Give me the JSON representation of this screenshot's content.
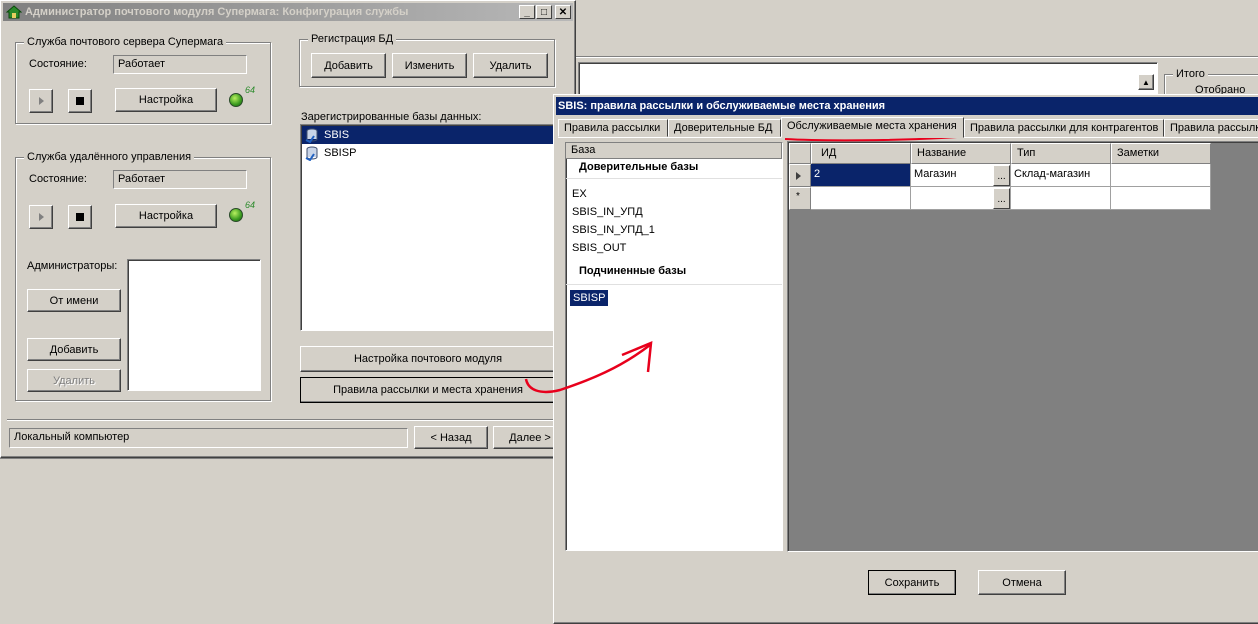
{
  "main_window": {
    "title": "Администратор почтового модуля Супермага: Конфигурация службы",
    "mail_service": {
      "group_title": "Служба почтового сервера Супермага",
      "state_label": "Состояние:",
      "state_value": "Работает",
      "settings_button": "Настройка",
      "led_number": "64"
    },
    "remote_service": {
      "group_title": "Служба удалённого управления",
      "state_label": "Состояние:",
      "state_value": "Работает",
      "settings_button": "Настройка",
      "led_number": "64"
    },
    "admins": {
      "label": "Администраторы:",
      "as_user_button": "От имени",
      "add_button": "Добавить",
      "delete_button": "Удалить"
    },
    "db_registration": {
      "group_title": "Регистрация БД",
      "add_button": "Добавить",
      "edit_button": "Изменить",
      "delete_button": "Удалить"
    },
    "registered_dbs": {
      "label": "Зарегистрированные базы данных:",
      "items": [
        "SBIS",
        "SBISP"
      ],
      "selected": "SBIS"
    },
    "mail_module_settings_button": "Настройка почтового модуля",
    "rules_button": "Правила рассылки и места хранения",
    "status_field": "Локальный компьютер",
    "back_button": "< Назад",
    "next_button": "Далее >"
  },
  "background_panel": {
    "total_label": "Итого",
    "shown_label": "Отобрано"
  },
  "dialog": {
    "title": "SBIS: правила рассылки и обслуживаемые места хранения",
    "tabs": [
      "Правила рассылки",
      "Доверительные БД",
      "Обслуживаемые места хранения",
      "Правила рассылки для контрагентов",
      "Правила рассылк"
    ],
    "active_tab": "Обслуживаемые места хранения",
    "bases": {
      "header": "База",
      "trusted_title": "Доверительные базы",
      "trusted_items": [
        "EX",
        "SBIS_IN_УПД",
        "SBIS_IN_УПД_1",
        "SBIS_OUT"
      ],
      "sub_title": "Подчиненные базы",
      "sub_items": [
        "SBISP"
      ],
      "selected": "SBISP"
    },
    "grid": {
      "columns": [
        "ИД",
        "Название",
        "Тип",
        "Заметки"
      ],
      "rows": [
        {
          "id": "2",
          "name": "Магазин",
          "type": "Склад-магазин",
          "notes": ""
        }
      ],
      "new_row_marker": "*",
      "ellipsis": "..."
    },
    "save_button": "Сохранить",
    "cancel_button": "Отмена"
  },
  "colors": {
    "active_title": "#0a246a",
    "inactive_title": "#808080",
    "annotation": "#e8001c",
    "grid_bg": "#808080"
  }
}
